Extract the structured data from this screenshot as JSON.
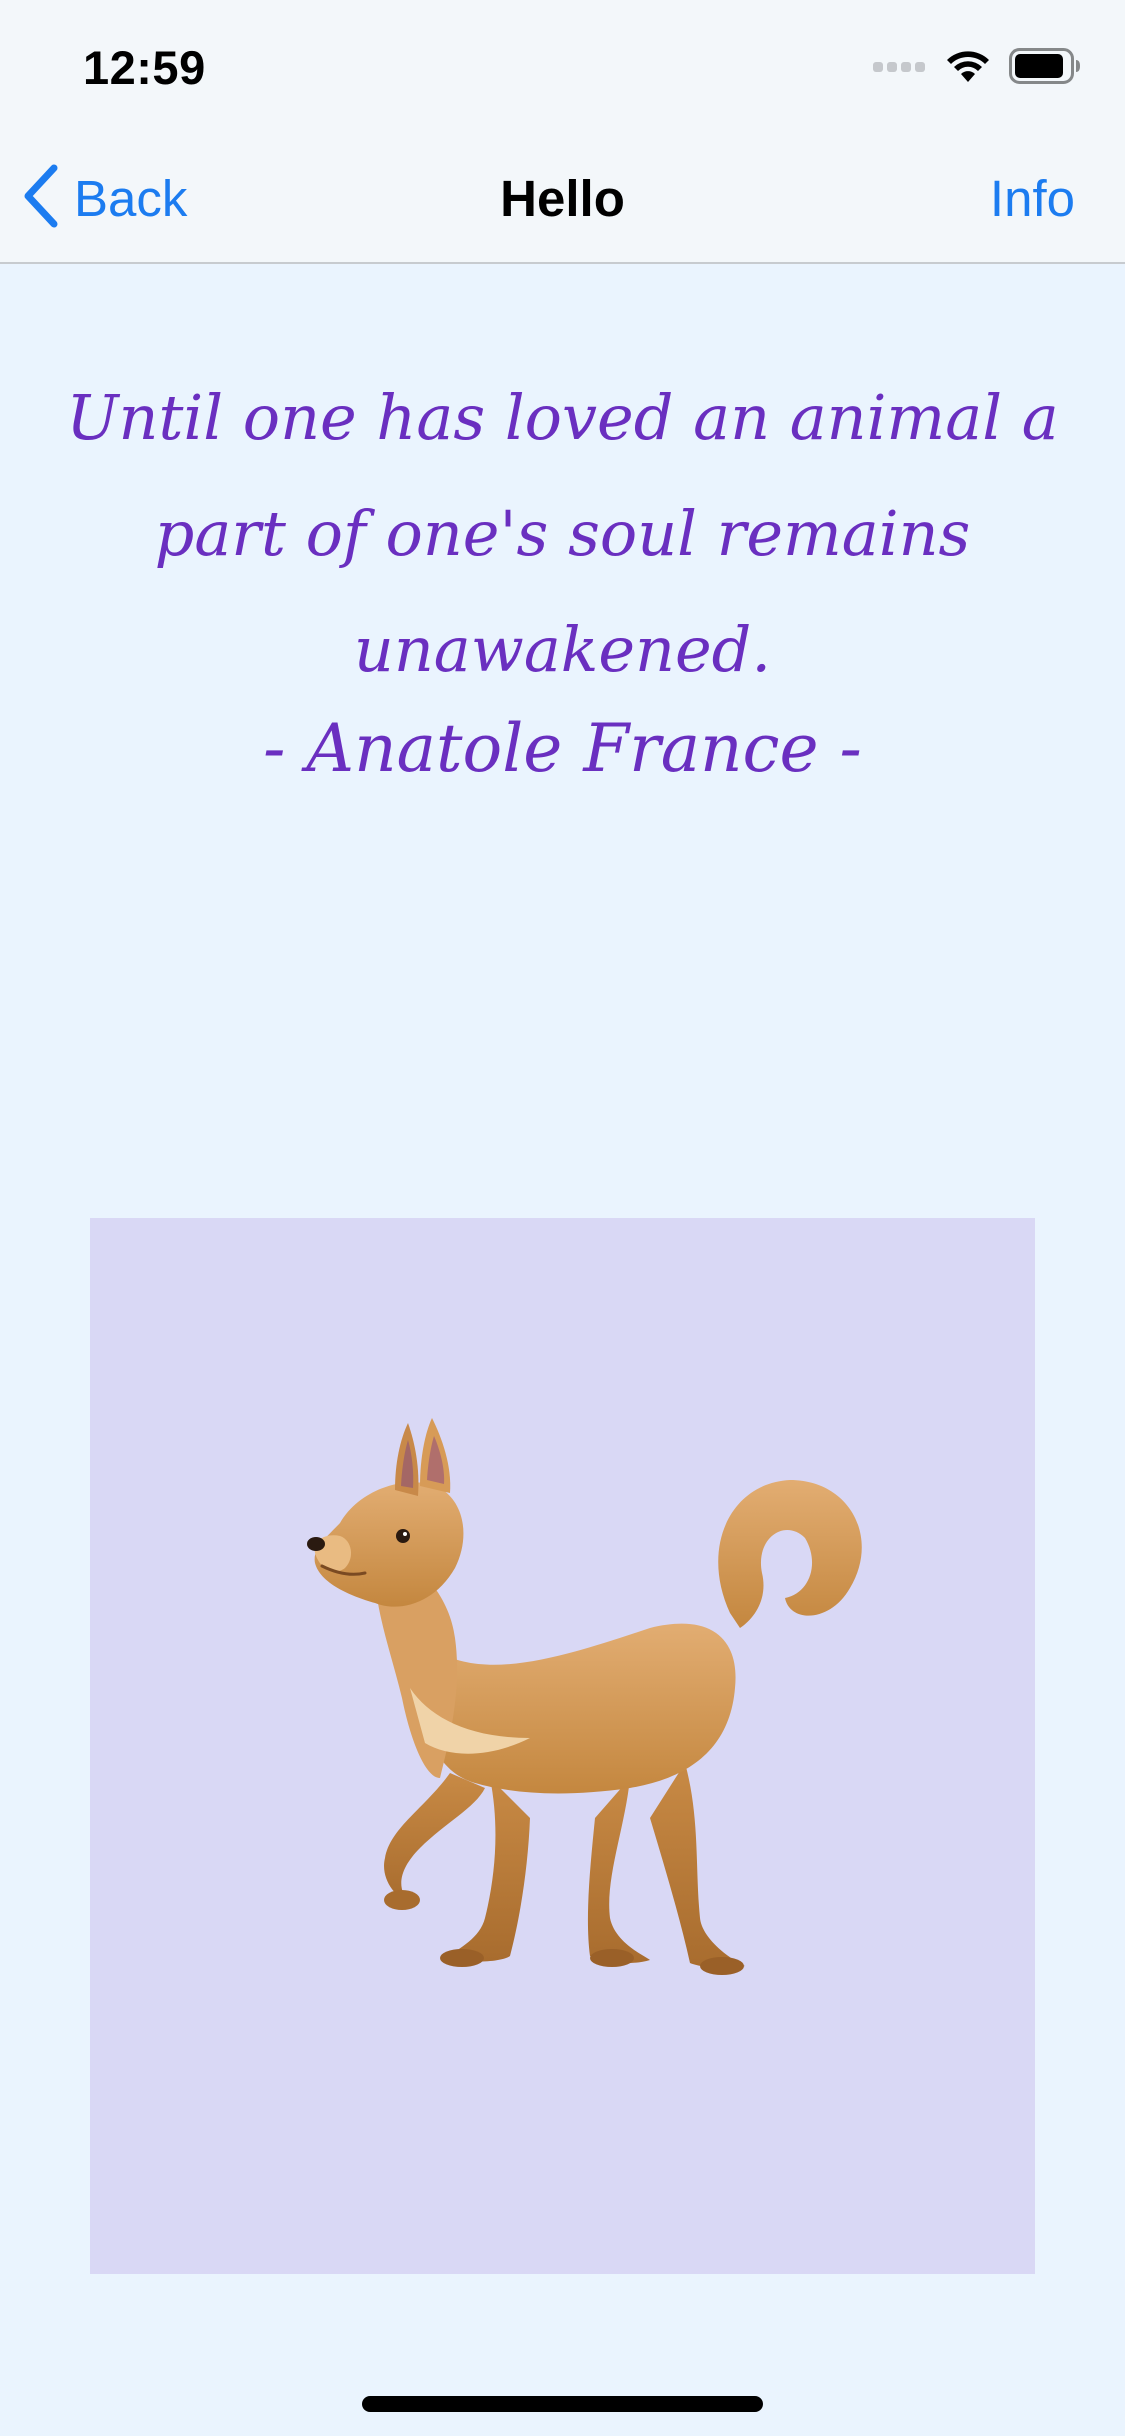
{
  "status_bar": {
    "time": "12:59",
    "icons": [
      "cellular-signal-icon",
      "wifi-icon",
      "battery-icon"
    ]
  },
  "nav": {
    "back_label": "Back",
    "title": "Hello",
    "info_label": "Info"
  },
  "content": {
    "quote": "Until one has loved an animal a part of one's soul remains unawakened.",
    "author": "- Anatole France -",
    "image": "dog-emoji"
  },
  "colors": {
    "accent": "#1c7cf0",
    "quote_text": "#6a2fc0",
    "background": "#eaf4fe",
    "bar_background": "#f3f7fa",
    "image_panel": "#d9d8f5"
  }
}
